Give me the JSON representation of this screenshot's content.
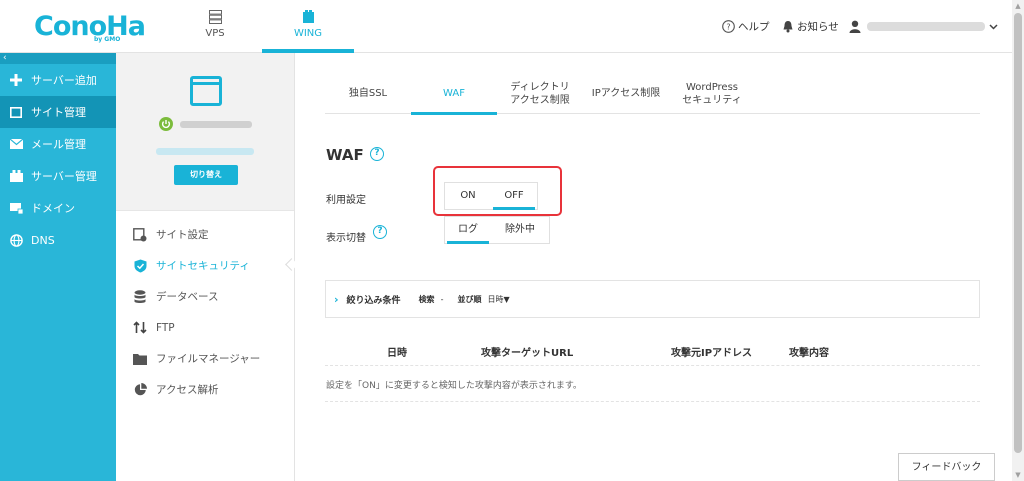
{
  "brand": {
    "logo": "ConoHa",
    "logo_sub": "by GMO",
    "accent": "#19b3d7"
  },
  "services": [
    {
      "label": "VPS",
      "icon": "server-icon"
    },
    {
      "label": "WING",
      "icon": "wing-icon"
    }
  ],
  "topbar": {
    "help": "ヘルプ",
    "notice": "お知らせ"
  },
  "leftnav": {
    "collapse": "‹",
    "items": [
      {
        "label": "サーバー追加",
        "icon": "plus-icon"
      },
      {
        "label": "サイト管理",
        "icon": "site-icon"
      },
      {
        "label": "メール管理",
        "icon": "mail-icon"
      },
      {
        "label": "サーバー管理",
        "icon": "server-stack-icon"
      },
      {
        "label": "ドメイン",
        "icon": "domain-icon"
      },
      {
        "label": "DNS",
        "icon": "globe-icon"
      }
    ]
  },
  "subnav": {
    "switch_button": "切り替え",
    "items": [
      {
        "label": "サイト設定",
        "icon": "site-settings-icon"
      },
      {
        "label": "サイトセキュリティ",
        "icon": "shield-icon"
      },
      {
        "label": "データベース",
        "icon": "database-icon"
      },
      {
        "label": "FTP",
        "icon": "ftp-icon"
      },
      {
        "label": "ファイルマネージャー",
        "icon": "folder-icon"
      },
      {
        "label": "アクセス解析",
        "icon": "pie-chart-icon"
      }
    ]
  },
  "tabs": [
    {
      "label": "独自SSL"
    },
    {
      "label": "WAF"
    },
    {
      "line1": "ディレクトリ",
      "line2": "アクセス制限"
    },
    {
      "label": "IPアクセス制限"
    },
    {
      "line1": "WordPress",
      "line2": "セキュリティ"
    }
  ],
  "waf": {
    "title": "WAF",
    "help_mark": "?",
    "usage_label": "利用設定",
    "usage_options": [
      "ON",
      "OFF"
    ],
    "usage_selected": "OFF",
    "display_label": "表示切替",
    "display_options": [
      "ログ",
      "除外中"
    ],
    "display_selected": "ログ"
  },
  "filter": {
    "title": "絞り込み条件",
    "search_label": "検索",
    "search_value": "-",
    "sort_label": "並び順",
    "sort_value": "日時▼"
  },
  "table": {
    "columns": [
      "日時",
      "攻撃ターゲットURL",
      "攻撃元IPアドレス",
      "攻撃内容"
    ],
    "empty_note": "設定を「ON」に変更すると検知した攻撃内容が表示されます。"
  },
  "feedback_button": "フィードバック"
}
